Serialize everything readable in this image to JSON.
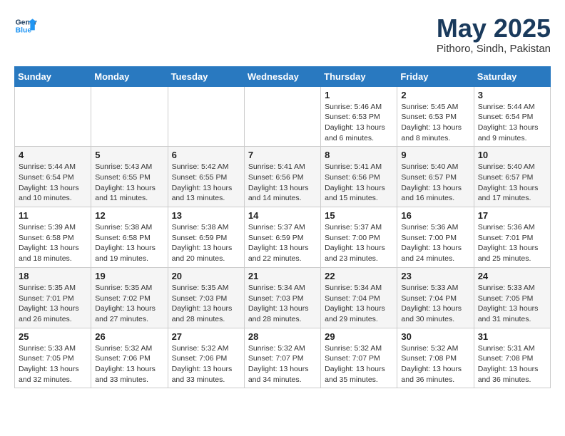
{
  "header": {
    "logo_line1": "General",
    "logo_line2": "Blue",
    "month_year": "May 2025",
    "location": "Pithoro, Sindh, Pakistan"
  },
  "days_of_week": [
    "Sunday",
    "Monday",
    "Tuesday",
    "Wednesday",
    "Thursday",
    "Friday",
    "Saturday"
  ],
  "weeks": [
    [
      {
        "day": "",
        "info": ""
      },
      {
        "day": "",
        "info": ""
      },
      {
        "day": "",
        "info": ""
      },
      {
        "day": "",
        "info": ""
      },
      {
        "day": "1",
        "info": "Sunrise: 5:46 AM\nSunset: 6:53 PM\nDaylight: 13 hours\nand 6 minutes."
      },
      {
        "day": "2",
        "info": "Sunrise: 5:45 AM\nSunset: 6:53 PM\nDaylight: 13 hours\nand 8 minutes."
      },
      {
        "day": "3",
        "info": "Sunrise: 5:44 AM\nSunset: 6:54 PM\nDaylight: 13 hours\nand 9 minutes."
      }
    ],
    [
      {
        "day": "4",
        "info": "Sunrise: 5:44 AM\nSunset: 6:54 PM\nDaylight: 13 hours\nand 10 minutes."
      },
      {
        "day": "5",
        "info": "Sunrise: 5:43 AM\nSunset: 6:55 PM\nDaylight: 13 hours\nand 11 minutes."
      },
      {
        "day": "6",
        "info": "Sunrise: 5:42 AM\nSunset: 6:55 PM\nDaylight: 13 hours\nand 13 minutes."
      },
      {
        "day": "7",
        "info": "Sunrise: 5:41 AM\nSunset: 6:56 PM\nDaylight: 13 hours\nand 14 minutes."
      },
      {
        "day": "8",
        "info": "Sunrise: 5:41 AM\nSunset: 6:56 PM\nDaylight: 13 hours\nand 15 minutes."
      },
      {
        "day": "9",
        "info": "Sunrise: 5:40 AM\nSunset: 6:57 PM\nDaylight: 13 hours\nand 16 minutes."
      },
      {
        "day": "10",
        "info": "Sunrise: 5:40 AM\nSunset: 6:57 PM\nDaylight: 13 hours\nand 17 minutes."
      }
    ],
    [
      {
        "day": "11",
        "info": "Sunrise: 5:39 AM\nSunset: 6:58 PM\nDaylight: 13 hours\nand 18 minutes."
      },
      {
        "day": "12",
        "info": "Sunrise: 5:38 AM\nSunset: 6:58 PM\nDaylight: 13 hours\nand 19 minutes."
      },
      {
        "day": "13",
        "info": "Sunrise: 5:38 AM\nSunset: 6:59 PM\nDaylight: 13 hours\nand 20 minutes."
      },
      {
        "day": "14",
        "info": "Sunrise: 5:37 AM\nSunset: 6:59 PM\nDaylight: 13 hours\nand 22 minutes."
      },
      {
        "day": "15",
        "info": "Sunrise: 5:37 AM\nSunset: 7:00 PM\nDaylight: 13 hours\nand 23 minutes."
      },
      {
        "day": "16",
        "info": "Sunrise: 5:36 AM\nSunset: 7:00 PM\nDaylight: 13 hours\nand 24 minutes."
      },
      {
        "day": "17",
        "info": "Sunrise: 5:36 AM\nSunset: 7:01 PM\nDaylight: 13 hours\nand 25 minutes."
      }
    ],
    [
      {
        "day": "18",
        "info": "Sunrise: 5:35 AM\nSunset: 7:01 PM\nDaylight: 13 hours\nand 26 minutes."
      },
      {
        "day": "19",
        "info": "Sunrise: 5:35 AM\nSunset: 7:02 PM\nDaylight: 13 hours\nand 27 minutes."
      },
      {
        "day": "20",
        "info": "Sunrise: 5:35 AM\nSunset: 7:03 PM\nDaylight: 13 hours\nand 28 minutes."
      },
      {
        "day": "21",
        "info": "Sunrise: 5:34 AM\nSunset: 7:03 PM\nDaylight: 13 hours\nand 28 minutes."
      },
      {
        "day": "22",
        "info": "Sunrise: 5:34 AM\nSunset: 7:04 PM\nDaylight: 13 hours\nand 29 minutes."
      },
      {
        "day": "23",
        "info": "Sunrise: 5:33 AM\nSunset: 7:04 PM\nDaylight: 13 hours\nand 30 minutes."
      },
      {
        "day": "24",
        "info": "Sunrise: 5:33 AM\nSunset: 7:05 PM\nDaylight: 13 hours\nand 31 minutes."
      }
    ],
    [
      {
        "day": "25",
        "info": "Sunrise: 5:33 AM\nSunset: 7:05 PM\nDaylight: 13 hours\nand 32 minutes."
      },
      {
        "day": "26",
        "info": "Sunrise: 5:32 AM\nSunset: 7:06 PM\nDaylight: 13 hours\nand 33 minutes."
      },
      {
        "day": "27",
        "info": "Sunrise: 5:32 AM\nSunset: 7:06 PM\nDaylight: 13 hours\nand 33 minutes."
      },
      {
        "day": "28",
        "info": "Sunrise: 5:32 AM\nSunset: 7:07 PM\nDaylight: 13 hours\nand 34 minutes."
      },
      {
        "day": "29",
        "info": "Sunrise: 5:32 AM\nSunset: 7:07 PM\nDaylight: 13 hours\nand 35 minutes."
      },
      {
        "day": "30",
        "info": "Sunrise: 5:32 AM\nSunset: 7:08 PM\nDaylight: 13 hours\nand 36 minutes."
      },
      {
        "day": "31",
        "info": "Sunrise: 5:31 AM\nSunset: 7:08 PM\nDaylight: 13 hours\nand 36 minutes."
      }
    ]
  ]
}
